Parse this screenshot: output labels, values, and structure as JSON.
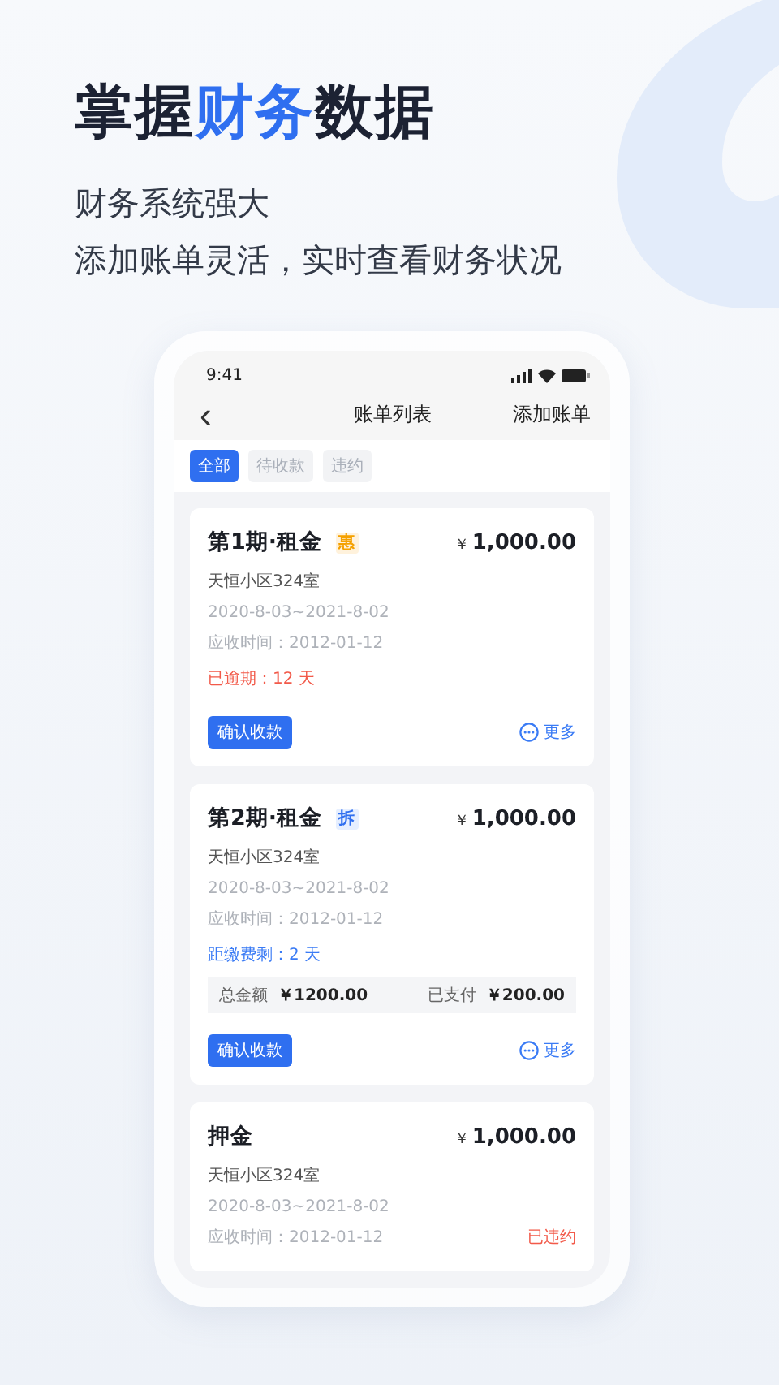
{
  "headline": [
    {
      "text": "掌握",
      "highlight": false
    },
    {
      "text": "财务",
      "highlight": true
    },
    {
      "text": "数据",
      "highlight": false
    }
  ],
  "subtitles": [
    "财务系统强大",
    "添加账单灵活，实时查看财务状况"
  ],
  "phone": {
    "status_bar": {
      "time": "9:41"
    },
    "nav": {
      "back": "‹",
      "title": "账单列表",
      "action": "添加账单"
    },
    "filters": [
      {
        "label": "全部",
        "selected": true
      },
      {
        "label": "待收款",
        "selected": false
      },
      {
        "label": "违约",
        "selected": false
      }
    ],
    "bills": [
      {
        "title": "第1期·租金",
        "tag": {
          "text": "惠",
          "kind": "discount"
        },
        "currency": "￥",
        "amount": "1,000.00",
        "address": "天恒小区324室",
        "period": "2020-8-03~2021-8-02",
        "due_date": "应收时间：2012-01-12",
        "status": {
          "text": "已逾期：12 天",
          "kind": "overdue"
        },
        "confirm_button": "确认收款",
        "more": "更多"
      },
      {
        "title": "第2期·租金",
        "tag": {
          "text": "拆",
          "kind": "split"
        },
        "currency": "￥",
        "amount": "1,000.00",
        "address": "天恒小区324室",
        "period": "2020-8-03~2021-8-02",
        "due_date": "应收时间：2012-01-12",
        "status": {
          "text": "距缴费剩：2 天",
          "kind": "remaining"
        },
        "summary": {
          "total_label": "总金额",
          "total": "￥1200.00",
          "paid_label": "已支付",
          "paid": "￥200.00"
        },
        "confirm_button": "确认收款",
        "more": "更多"
      },
      {
        "title": "押金",
        "currency": "￥",
        "amount": "1,000.00",
        "address": "天恒小区324室",
        "period": "2020-8-03~2021-8-02",
        "due_date": "应收时间：2012-01-12",
        "status": {
          "text": "已违约",
          "kind": "breached"
        }
      }
    ]
  }
}
